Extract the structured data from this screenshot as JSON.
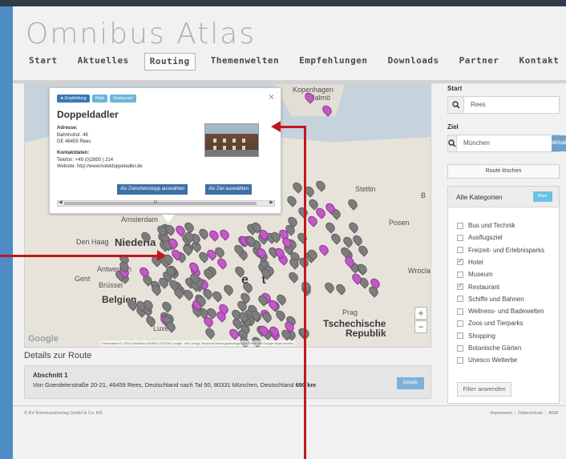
{
  "site": {
    "logo": "Omnibus Atlas"
  },
  "nav": {
    "items": [
      "Start",
      "Aktuelles",
      "Routing",
      "Themenwelten",
      "Empfehlungen",
      "Downloads",
      "Partner",
      "Kontakt"
    ],
    "active": "Routing"
  },
  "map": {
    "labels": {
      "kopenhagen": "Kopenhagen",
      "malmo": "Malmö",
      "stettin": "Stettin",
      "posen": "Posen",
      "wroclaw": "Wroclaw",
      "amsterdam": "Amsterdam",
      "den_haag": "Den Haag",
      "niederlande": "Niederla",
      "antwerpen": "Antwerpen",
      "gent": "Gent",
      "brussel": "Brüssel",
      "belgien": "Belgien",
      "deutschland": "e  t",
      "prag": "Prag",
      "tschechische": "Tschechische",
      "republik": "Republik",
      "luxem": "Luxe",
      "b_edge": "B"
    },
    "google_logo": "Google",
    "attribution": "Kartendaten © 2016 GeoBasis-DE/BKG (©2009) Google, Inst. Geogr. Nacional   Nutzungsbedingungen   Fehler bei Google Maps melden",
    "zoom_in": "+",
    "zoom_out": "−"
  },
  "popup": {
    "close": "×",
    "badges": [
      "★ Empfehlung",
      "Hotel",
      "Restaurant"
    ],
    "title": "Doppeldadler",
    "address_label": "Adresse:",
    "address_line1": "Bahnhofstr. 48",
    "address_line2": "DE 46459 Rees",
    "contact_label": "Kontaktdaten:",
    "phone": "Telefon: +49 (0)2850 | 214",
    "website": "Website: http://www.hoteldoppeladler.de",
    "btn_zwischenstopp": "Als Zwischenstopp auswählen",
    "btn_ziel": "Als Ziel auswählen",
    "scroll_left": "◀",
    "scroll_right": "▶",
    "scroll_mid": "III"
  },
  "details": {
    "title": "Details zur Route",
    "section_title": "Abschnitt 1",
    "section_text_pre": "Von Goerdelerstraße 20-21, 46459 Rees, Deutschland nach Tal 50, 80331 München, Deutschland",
    "distance": "690 km",
    "btn": "Details"
  },
  "sidebar": {
    "start_label": "Start",
    "start_value": "Rees",
    "ziel_label": "Ziel",
    "ziel_value": "München",
    "aktualisieren": "aktualisieren",
    "route_loeschen": "Route löschen",
    "categories_header": "Alle Kategorien",
    "categories_toggle": "Mehr",
    "categories": [
      {
        "label": "Bus und Technik",
        "checked": false
      },
      {
        "label": "Ausflugsziel",
        "checked": false
      },
      {
        "label": "Freizeit- und Erlebnisparks",
        "checked": false
      },
      {
        "label": "Hotel",
        "checked": true
      },
      {
        "label": "Museum",
        "checked": false
      },
      {
        "label": "Restaurant",
        "checked": true
      },
      {
        "label": "Schiffe und Bahnen",
        "checked": false
      },
      {
        "label": "Wellness- und Badewelten",
        "checked": false
      },
      {
        "label": "Zoos und Tierparks",
        "checked": false
      },
      {
        "label": "Shopping",
        "checked": false
      },
      {
        "label": "Botanische Gärten",
        "checked": false
      },
      {
        "label": "Unesco Welterbe",
        "checked": false
      }
    ],
    "filter_btn": "Filter anwenden"
  },
  "footer": {
    "copyright": "© KV Kommunalverlag GmbH & Co. KG",
    "links": [
      "Impressum",
      "Datenschutz",
      "AGB"
    ]
  },
  "colors": {
    "accent_blue": "#3e6fa6",
    "annotation_red": "#c3161c",
    "marker_pink": "#c159c7",
    "marker_gray": "#7d7d7d"
  }
}
